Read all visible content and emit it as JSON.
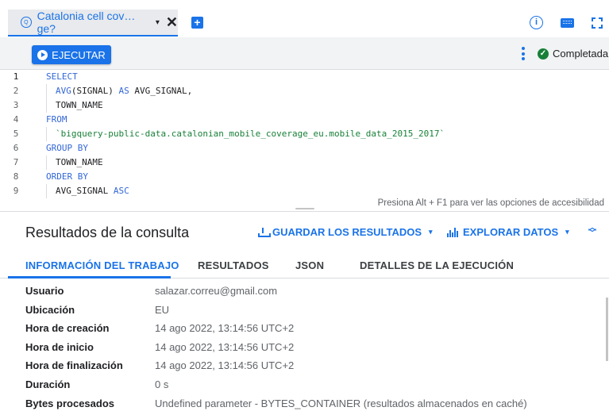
{
  "tab": {
    "title": "Catalonia cell cov…ge?",
    "caret": "▾",
    "close": "✕"
  },
  "new_tab": "+",
  "icons": {
    "info": "i"
  },
  "toolbar": {
    "run_label": "EJECUTAR",
    "status": "Completada"
  },
  "editor": {
    "lines": [
      {
        "n": "1",
        "indent": false,
        "parts": [
          {
            "t": "SELECT",
            "c": "kw"
          }
        ]
      },
      {
        "n": "2",
        "indent": true,
        "parts": [
          {
            "t": "AVG",
            "c": "fn"
          },
          {
            "t": "(SIGNAL) ",
            "c": ""
          },
          {
            "t": "AS",
            "c": "kw"
          },
          {
            "t": " AVG_SIGNAL,",
            "c": ""
          }
        ]
      },
      {
        "n": "3",
        "indent": true,
        "parts": [
          {
            "t": "TOWN_NAME",
            "c": ""
          }
        ]
      },
      {
        "n": "4",
        "indent": false,
        "parts": [
          {
            "t": "FROM",
            "c": "kw"
          }
        ]
      },
      {
        "n": "5",
        "indent": true,
        "parts": [
          {
            "t": "`bigquery-public-data.catalonian_mobile_coverage_eu.mobile_data_2015_2017`",
            "c": "str"
          }
        ]
      },
      {
        "n": "6",
        "indent": false,
        "parts": [
          {
            "t": "GROUP BY",
            "c": "kw"
          }
        ]
      },
      {
        "n": "7",
        "indent": true,
        "parts": [
          {
            "t": "TOWN_NAME",
            "c": ""
          }
        ]
      },
      {
        "n": "8",
        "indent": false,
        "parts": [
          {
            "t": "ORDER BY",
            "c": "kw"
          }
        ]
      },
      {
        "n": "9",
        "indent": true,
        "parts": [
          {
            "t": "AVG_SIGNAL ",
            "c": ""
          },
          {
            "t": "ASC",
            "c": "kw"
          }
        ]
      }
    ],
    "a11y_hint": "Presiona Alt + F1 para ver las opciones de accesibilidad"
  },
  "results": {
    "title": "Resultados de la consulta",
    "save_label": "GUARDAR LOS RESULTADOS",
    "explore_label": "EXPLORAR DATOS",
    "caret": "▾"
  },
  "tabs": [
    {
      "label": "INFORMACIÓN DEL TRABAJO",
      "active": true
    },
    {
      "label": "RESULTADOS",
      "active": false
    },
    {
      "label": "JSON",
      "active": false
    },
    {
      "label": "DETALLES DE LA EJECUCIÓN",
      "active": false
    }
  ],
  "job_info": [
    {
      "key": "Usuario",
      "value": "salazar.correu@gmail.com"
    },
    {
      "key": "Ubicación",
      "value": "EU"
    },
    {
      "key": "Hora de creación",
      "value": "14 ago 2022, 13:14:56 UTC+2"
    },
    {
      "key": "Hora de inicio",
      "value": "14 ago 2022, 13:14:56 UTC+2"
    },
    {
      "key": "Hora de finalización",
      "value": "14 ago 2022, 13:14:56 UTC+2"
    },
    {
      "key": "Duración",
      "value": "0 s"
    },
    {
      "key": "Bytes procesados",
      "value": "Undefined parameter - BYTES_CONTAINER (resultados almacenados en caché)"
    }
  ],
  "colors": {
    "accent": "#1a73e8",
    "success": "#188038",
    "keyword": "#3367d6",
    "string": "#188038"
  }
}
